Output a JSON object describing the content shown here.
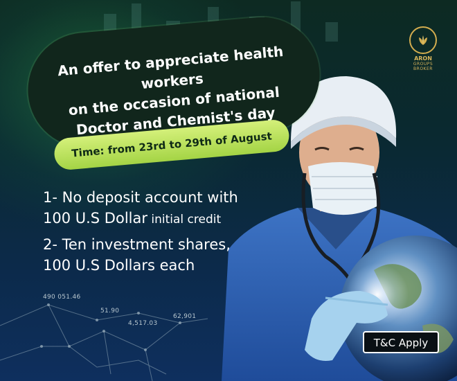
{
  "brand": {
    "line1": "ARON",
    "line2": "GROUPS",
    "line3": "BROKER",
    "color": "#d3ad4f",
    "icon": "leaf-icon"
  },
  "headline": {
    "line1": "An offer to appreciate health workers",
    "line2": "on the occasion of national",
    "line3": "Doctor and Chemist's day"
  },
  "time": {
    "label": "Time: from 23rd to 29th of August"
  },
  "benefits": {
    "b1_line1": "1- No deposit account with",
    "b1_line2_big": "100 U.S Dollar",
    "b1_line2_small": " initial credit",
    "b2_line1": "2- Ten investment shares,",
    "b2_line2": "100 U.S Dollars each"
  },
  "market_numbers": [
    "490 051.46",
    "51.90",
    "4,517.03",
    "62,901"
  ],
  "tc": {
    "label": "T&C Apply"
  },
  "colors": {
    "accent_green": "#a4d445",
    "dark_pill": "#11261c",
    "background": "#0c2a4a"
  }
}
